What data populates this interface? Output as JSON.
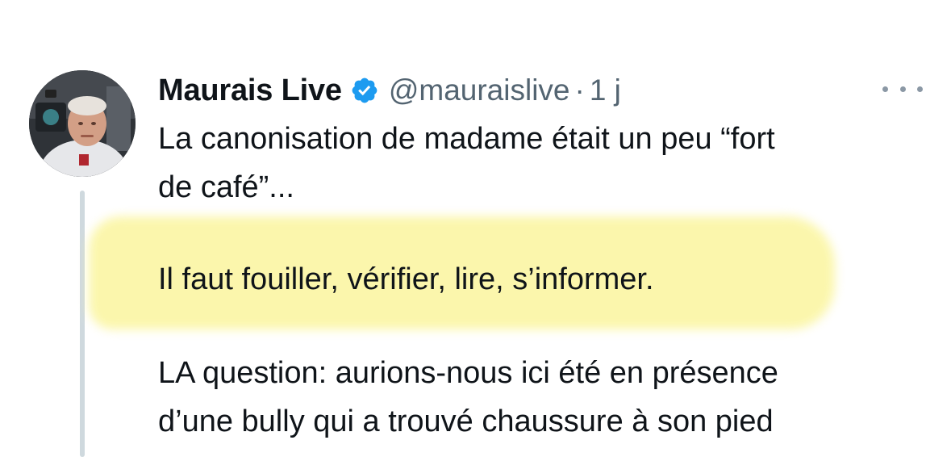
{
  "author": {
    "display_name": "Maurais Live",
    "handle": "@mauraislive",
    "separator": "·",
    "time": "1 j",
    "verified": true,
    "verified_color": "#1d9bf0"
  },
  "body": {
    "line1": "La canonisation de madame était un peu “fort",
    "line2": "de café”...",
    "highlighted_line": "Il faut fouiller, vérifier, lire, s’informer.",
    "line4": "LA question: aurions-nous ici été en présence",
    "line5": "d’une bully qui a trouvé chaussure à son pied"
  },
  "icons": {
    "verified": "verified-badge-icon",
    "more": "more-options-icon"
  },
  "colors": {
    "highlight": "#fbf6a8",
    "muted": "#536471",
    "text": "#0f1419"
  }
}
